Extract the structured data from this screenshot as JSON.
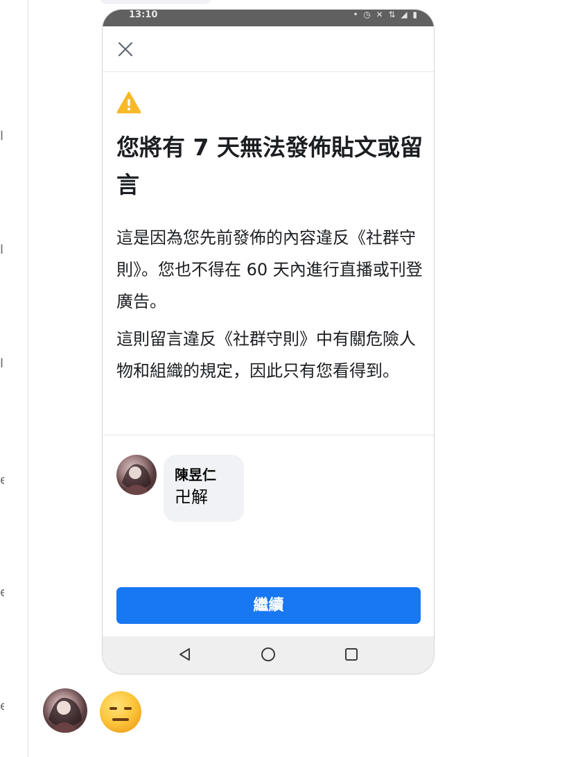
{
  "page": {
    "edge_glyphs": [
      "l",
      "l",
      "l",
      "e",
      "e",
      "e"
    ]
  },
  "phone": {
    "status_bar": {
      "time": "13:10",
      "icons_text": "• ◷ ✕ ⇅ ◢ ▮"
    },
    "close_icon": "close-icon",
    "warning_icon": "warning-triangle-icon",
    "headline": "您將有 7 天無法發佈貼文或留言",
    "paragraph_1": "這是因為您先前發佈的內容違反《社群守則》。您也不得在 60 天內進行直播或刊登廣告。",
    "paragraph_2": "這則留言違反《社群守則》中有關危險人物和組織的規定，因此只有您看得到。",
    "comment": {
      "author": "陳昱仁",
      "text": "卍解"
    },
    "continue_label": "繼續",
    "nav_icons": [
      "back-triangle-icon",
      "home-circle-icon",
      "recents-square-icon"
    ]
  },
  "reaction_emoji": "expressionless-face-emoji",
  "colors": {
    "primary_button": "#1877f2",
    "warning": "#f7b928",
    "status_bar": "#606060",
    "text": "#1c1e21",
    "bubble": "#f0f2f5"
  }
}
